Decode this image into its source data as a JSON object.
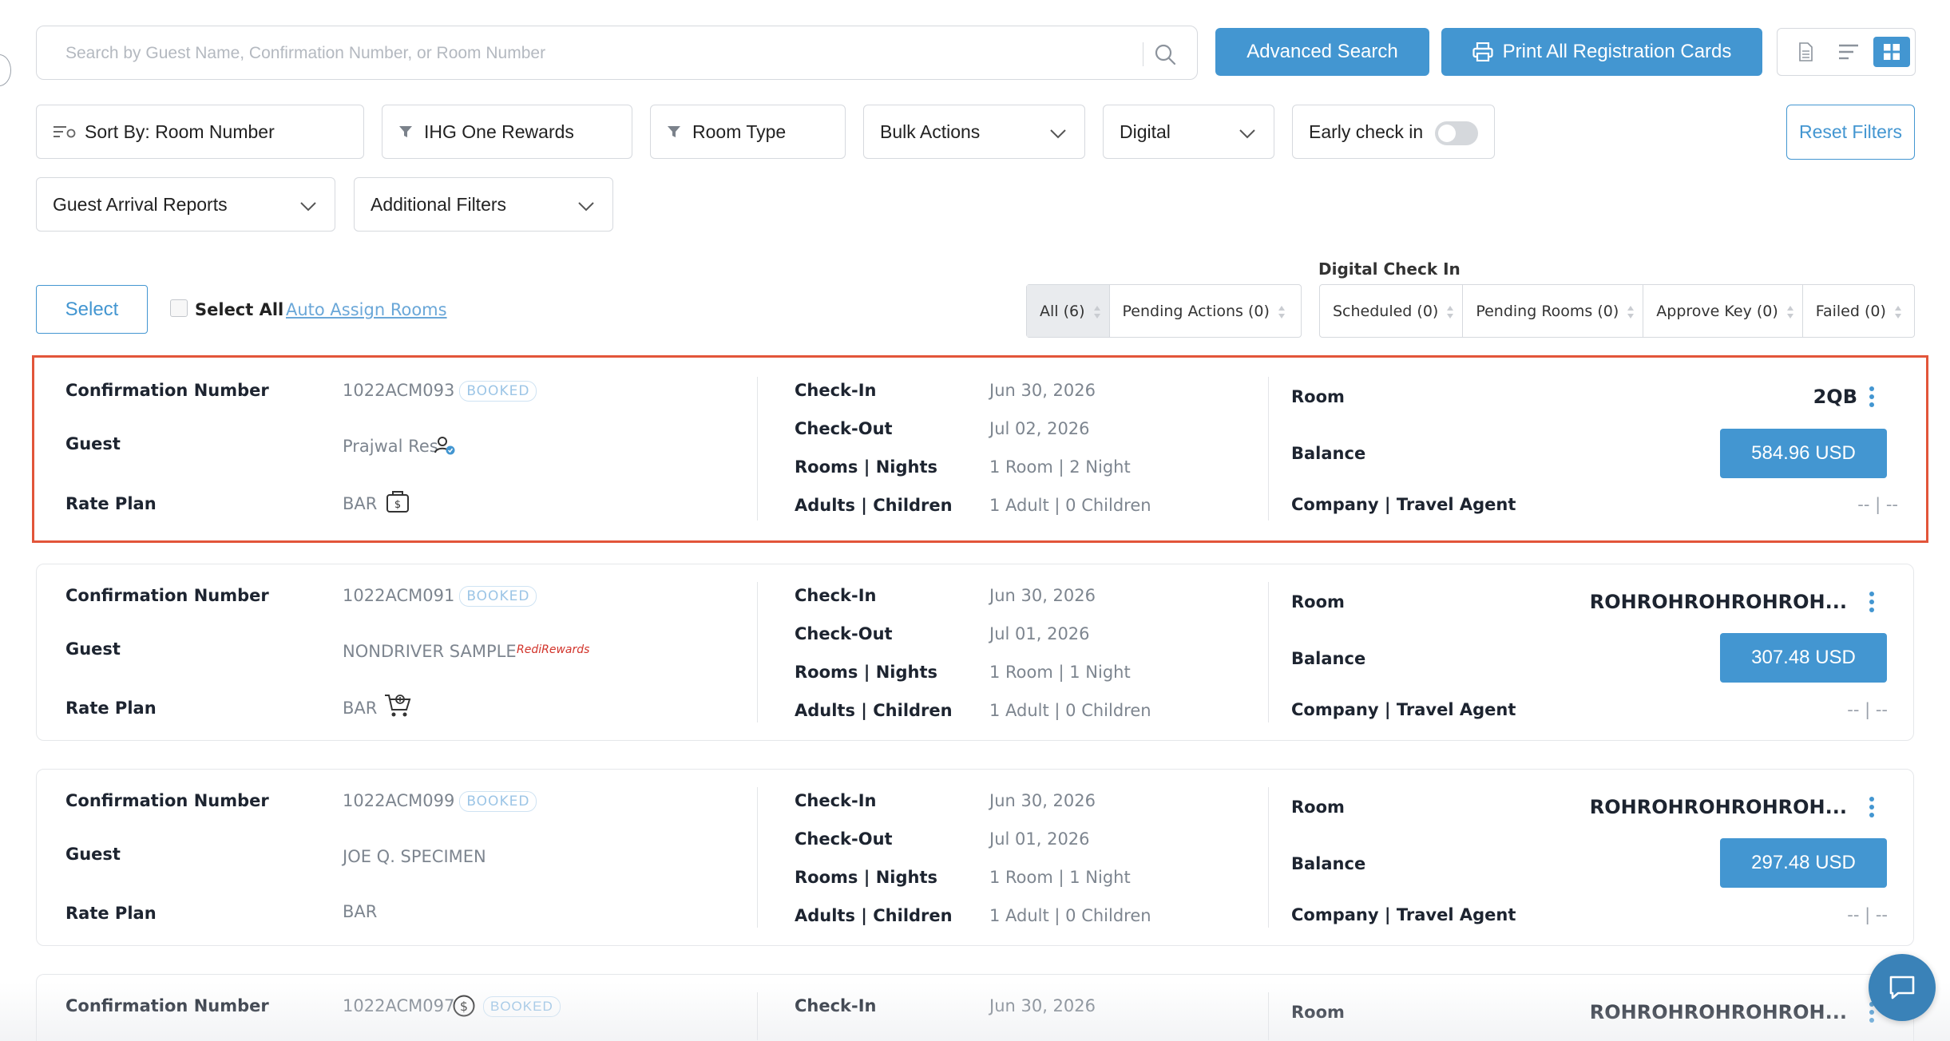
{
  "search": {
    "placeholder": "Search by Guest Name, Confirmation Number, or Room Number",
    "advanced_label": "Advanced Search",
    "print_label": "Print All Registration Cards"
  },
  "view_modes": [
    {
      "icon": "document-icon",
      "active": false
    },
    {
      "icon": "list-icon",
      "active": false
    },
    {
      "icon": "grid-icon",
      "active": true
    }
  ],
  "filters": {
    "sort_label": "Sort By: Room Number",
    "ihg_label": "IHG One Rewards",
    "room_type_label": "Room Type",
    "bulk_actions_label": "Bulk Actions",
    "digital_label": "Digital",
    "early_checkin_label": "Early check in",
    "early_checkin_on": false,
    "reset_label": "Reset Filters",
    "arrival_reports_label": "Guest Arrival Reports",
    "additional_filters_label": "Additional Filters"
  },
  "selection": {
    "select_label": "Select",
    "select_all_label": "Select All",
    "auto_assign_label": "Auto Assign Rooms"
  },
  "status_tabs": [
    {
      "label": "All (6)",
      "active": true
    },
    {
      "label": "Pending Actions (0)",
      "active": false
    }
  ],
  "digital_check_in": {
    "title": "Digital Check In",
    "tabs": [
      {
        "label": "Scheduled (0)"
      },
      {
        "label": "Pending Rooms (0)"
      },
      {
        "label": "Approve Key (0)"
      },
      {
        "label": "Failed (0)"
      }
    ]
  },
  "labels": {
    "confirmation": "Confirmation Number",
    "guest": "Guest",
    "rate_plan": "Rate Plan",
    "check_in": "Check-In",
    "check_out": "Check-Out",
    "rooms_nights": "Rooms | Nights",
    "adults_children": "Adults | Children",
    "room": "Room",
    "balance": "Balance",
    "company": "Company | Travel Agent"
  },
  "reservations": [
    {
      "confirmation": "1022ACM093",
      "status": "BOOKED",
      "guest": "Prajwal Res",
      "guest_icon": "verified-user-icon",
      "rate_plan": "BAR",
      "rate_icon": "money-bag-icon",
      "check_in": "Jun 30, 2026",
      "check_out": "Jul 02, 2026",
      "rooms_nights": "1 Room | 2 Night",
      "adults_children": "1 Adult | 0 Children",
      "room": "2QB",
      "balance": "584.96 USD",
      "company": "-- | --",
      "selected": true
    },
    {
      "confirmation": "1022ACM091",
      "status": "BOOKED",
      "guest": "NONDRIVER SAMPLE",
      "guest_icon": "red-rewards-logo",
      "guest_logo_text": "RediRewards",
      "rate_plan": "BAR",
      "rate_icon": "cart-plus-icon",
      "check_in": "Jun 30, 2026",
      "check_out": "Jul 01, 2026",
      "rooms_nights": "1 Room | 1 Night",
      "adults_children": "1 Adult | 0 Children",
      "room": "ROHROHROHROHROH...",
      "balance": "307.48 USD",
      "company": "-- | --",
      "selected": false
    },
    {
      "confirmation": "1022ACM099",
      "status": "BOOKED",
      "guest": "JOE Q. SPECIMEN",
      "rate_plan": "BAR",
      "check_in": "Jun 30, 2026",
      "check_out": "Jul 01, 2026",
      "rooms_nights": "1 Room | 1 Night",
      "adults_children": "1 Adult | 0 Children",
      "room": "ROHROHROHROHROH...",
      "balance": "297.48 USD",
      "company": "-- | --",
      "selected": false
    },
    {
      "confirmation": "1022ACM097",
      "status": "BOOKED",
      "confirmation_icon": "dollar-circle-icon",
      "check_in": "Jun 30, 2026",
      "room": "ROHROHROHROHROH...",
      "selected": false
    }
  ],
  "colors": {
    "accent": "#4396d1",
    "selected_border": "#e2553a",
    "badge": "#9cc5e6"
  }
}
